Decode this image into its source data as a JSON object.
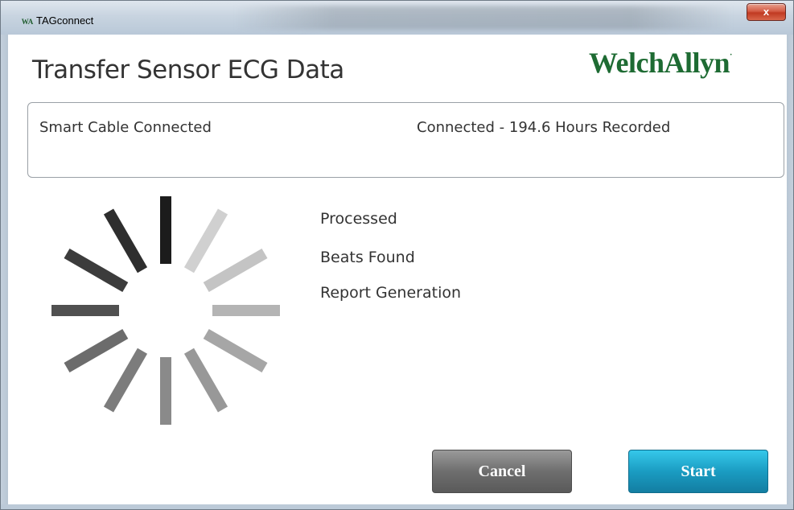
{
  "window": {
    "title": "TAGconnect",
    "app_icon_text": "WA",
    "close_label": "x"
  },
  "page": {
    "title": "Transfer Sensor ECG Data",
    "logo": "WelchAllyn",
    "logo_mark": "·"
  },
  "status": {
    "left": "Smart Cable Connected",
    "right": "Connected - 194.6 Hours Recorded"
  },
  "progress": {
    "items": [
      "Processed",
      "Beats Found",
      "Report Generation"
    ]
  },
  "buttons": {
    "cancel": "Cancel",
    "start": "Start"
  },
  "colors": {
    "logo": "#1e6b33",
    "start_button": "#1a9cc2",
    "cancel_button": "#6e6e6e"
  },
  "icons": {
    "spinner": "loading-spinner-icon",
    "close": "close-icon",
    "app": "app-icon"
  }
}
